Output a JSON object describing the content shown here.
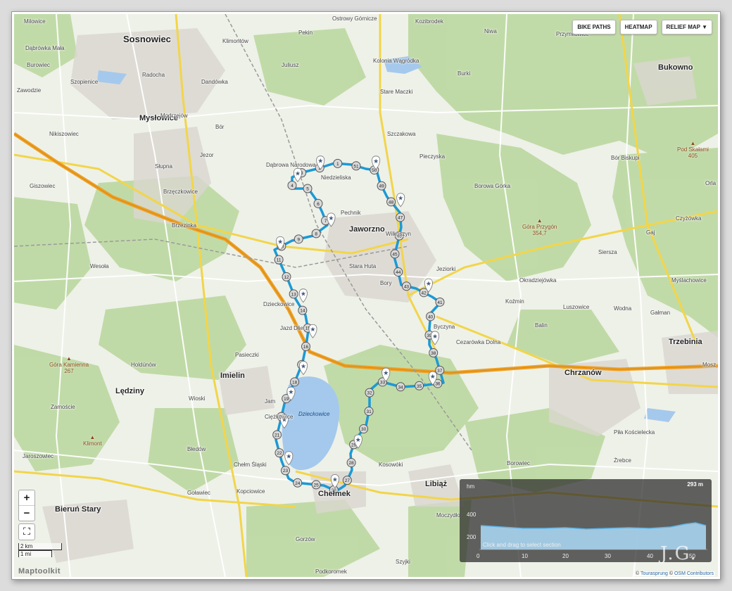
{
  "toolbar": {
    "bike_paths": "BIKE PATHS",
    "heatmap": "HEATMAP",
    "relief_map": "RELIEF MAP ▼"
  },
  "places": {
    "sosnowiec": "Sosnowiec",
    "myslowice": "Mysłowice",
    "jaworzno": "Jaworzno",
    "bukowno": "Bukowno",
    "trzebinia": "Trzebinia",
    "chrzanow": "Chrzanów",
    "imielin": "Imielin",
    "ledziny": "Lędziny",
    "bierun_stary": "Bieruń Stary",
    "libiaz": "Libiąż",
    "chelmek": "Chełmek",
    "milowice": "Milowice",
    "dabrowka_mala": "Dąbrówka Mała",
    "burowiec": "Burowiec",
    "szopienice": "Szopienice",
    "zawodzie": "Zawodzie",
    "radocha": "Radocha",
    "klimontow": "Klimontów",
    "pekin": "Pekin",
    "ostrowy_gornicze": "Ostrowy Górnicze",
    "kozibrodek": "Kozibrodek",
    "niwa": "Niwa",
    "przymilowice": "Przymiłowice",
    "kolonia_wagrodka": "Kolonia Wągródka",
    "burki": "Burki",
    "stare_maczki": "Stare Maczki",
    "juliusz": "Juliusz",
    "dandowka": "Dandówka",
    "modrzejow": "Modrzejów",
    "bor": "Bór",
    "szczakowa": "Szczakowa",
    "jezor": "Jezor",
    "nikiszowiec": "Nikiszowiec",
    "giszowiec": "Giszowiec",
    "slupna": "Słupna",
    "brzezinka": "Brzezinka",
    "brzeczkowice": "Brzęczkowice",
    "wesola": "Wesoła",
    "dabrowa_narodowa": "Dąbrowa Narodowa",
    "niedzieliska": "Niedzieliska",
    "pechnik": "Pechnik",
    "pieczyska": "Pieczyska",
    "borowa_gorka": "Borowa Górka",
    "bor_biskupi": "Bór Biskupi",
    "gaj": "Gaj",
    "czyzowka": "Czyżówka",
    "siersza": "Siersza",
    "myslachowice": "Myślachowice",
    "okradziejowka": "Okradziejówka",
    "luszowice": "Luszowice",
    "wodna": "Wodna",
    "galman": "Gałman",
    "balin": "Balin",
    "kozmin": "Koźmin",
    "jeziorki": "Jeziorki",
    "ciezkowice": "Ciężkowice",
    "bory": "Bory",
    "stara_huta": "Stara Huta",
    "wilkoszyn": "Wilkoszyn",
    "byczyna": "Byczyna",
    "cezarowka_dolna": "Cezarówka Dolna",
    "dzieckowice": "Dzieckowice",
    "jazd_dzieckowice": "Jazd Dłie",
    "pasieczki": "Pasieczki",
    "holdunow": "Holdúnów",
    "wioski": "Wioski",
    "zamoscie": "Zamoście",
    "bledow": "Błedów",
    "chelm_slaski": "Chełm Śląski",
    "golawiec": "Goławiec",
    "kopciowice": "Kopciowice",
    "jaroszowiec": "Jaroszowiec",
    "kosowki": "Kosowóki",
    "borowiec": "Borowiec",
    "moczydlo": "Moczydło",
    "gorzow": "Gorzów",
    "szyjki": "Szyjki",
    "podkoromek": "Podkoromek",
    "pila_koscielecka": "Piła Kościelecka",
    "zrebce": "Żrebce",
    "moszna": "Mosz",
    "orla": "Orla",
    "jamnice": "Jam",
    "kopiec": "Pod Skałami"
  },
  "peaks": [
    {
      "name": "Góra Przygón",
      "elev": "354,7"
    },
    {
      "name": "Góra Kamienna",
      "elev": "267"
    },
    {
      "name": "Pod Skałami",
      "elev": "405"
    },
    {
      "name": "Klimont",
      "elev": ""
    }
  ],
  "lake": {
    "name": "Dzieckowice"
  },
  "route": {
    "color": "#1b9ad6",
    "waypoint_labels": [
      "1",
      "2",
      "3",
      "4",
      "5",
      "6",
      "7",
      "8",
      "9",
      "10",
      "11",
      "12",
      "13",
      "14",
      "15",
      "16",
      "17",
      "18",
      "19",
      "20",
      "21",
      "22",
      "23",
      "24",
      "25",
      "26",
      "27",
      "28",
      "29",
      "30",
      "31",
      "32",
      "33",
      "34",
      "35",
      "36",
      "37",
      "38",
      "39",
      "40",
      "41",
      "42",
      "43",
      "44",
      "45",
      "46",
      "47",
      "48",
      "49",
      "50",
      "51"
    ]
  },
  "controls": {
    "zoom_in": "+",
    "zoom_out": "−",
    "fullscreen": "⛶"
  },
  "scale": {
    "km": "2 km",
    "mi": "1 mi"
  },
  "brand": "Maptoolkit",
  "attribution": {
    "copy1": "©",
    "touraprung": "Tourasprung",
    "copy2": "©",
    "osm": "OSM Contributors"
  },
  "elevation": {
    "unit": "hm",
    "y_ticks": [
      "400",
      "200"
    ],
    "x_ticks": [
      "0",
      "10",
      "20",
      "30",
      "40",
      "50"
    ],
    "max_label": "293 m",
    "hint": "Click and drag to select section"
  },
  "signature": "J.G."
}
